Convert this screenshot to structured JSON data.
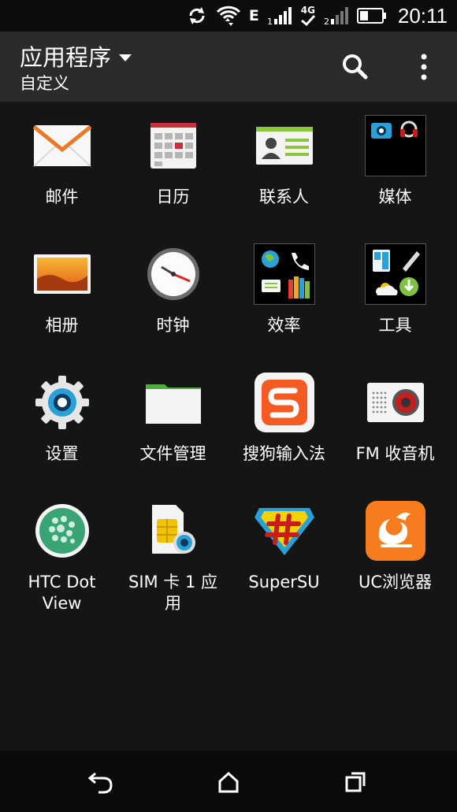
{
  "status": {
    "network_label": "E",
    "network_4g": "4G",
    "time": "20:11"
  },
  "header": {
    "title": "应用程序",
    "subtitle": "自定义"
  },
  "apps": [
    {
      "label": "邮件",
      "icon": "mail-icon"
    },
    {
      "label": "日历",
      "icon": "calendar-icon"
    },
    {
      "label": "联系人",
      "icon": "contacts-icon"
    },
    {
      "label": "媒体",
      "icon": "media-folder-icon"
    },
    {
      "label": "相册",
      "icon": "gallery-icon"
    },
    {
      "label": "时钟",
      "icon": "clock-icon"
    },
    {
      "label": "效率",
      "icon": "productivity-folder-icon"
    },
    {
      "label": "工具",
      "icon": "tools-folder-icon"
    },
    {
      "label": "设置",
      "icon": "settings-gear-icon"
    },
    {
      "label": "文件管理",
      "icon": "file-manager-folder-icon"
    },
    {
      "label": "搜狗输入法",
      "icon": "sogou-input-icon"
    },
    {
      "label": "FM 收音机",
      "icon": "fm-radio-icon"
    },
    {
      "label": "HTC Dot View",
      "icon": "dot-view-icon"
    },
    {
      "label": "SIM 卡 1 应用",
      "icon": "sim-card-icon"
    },
    {
      "label": "SuperSU",
      "icon": "supersu-icon"
    },
    {
      "label": "UC浏览器",
      "icon": "uc-browser-icon"
    }
  ],
  "colors": {
    "background": "#151515",
    "appbar": "#2b2b2b",
    "statusbar": "#0d0d0d",
    "navbar": "#0a0a0a"
  }
}
